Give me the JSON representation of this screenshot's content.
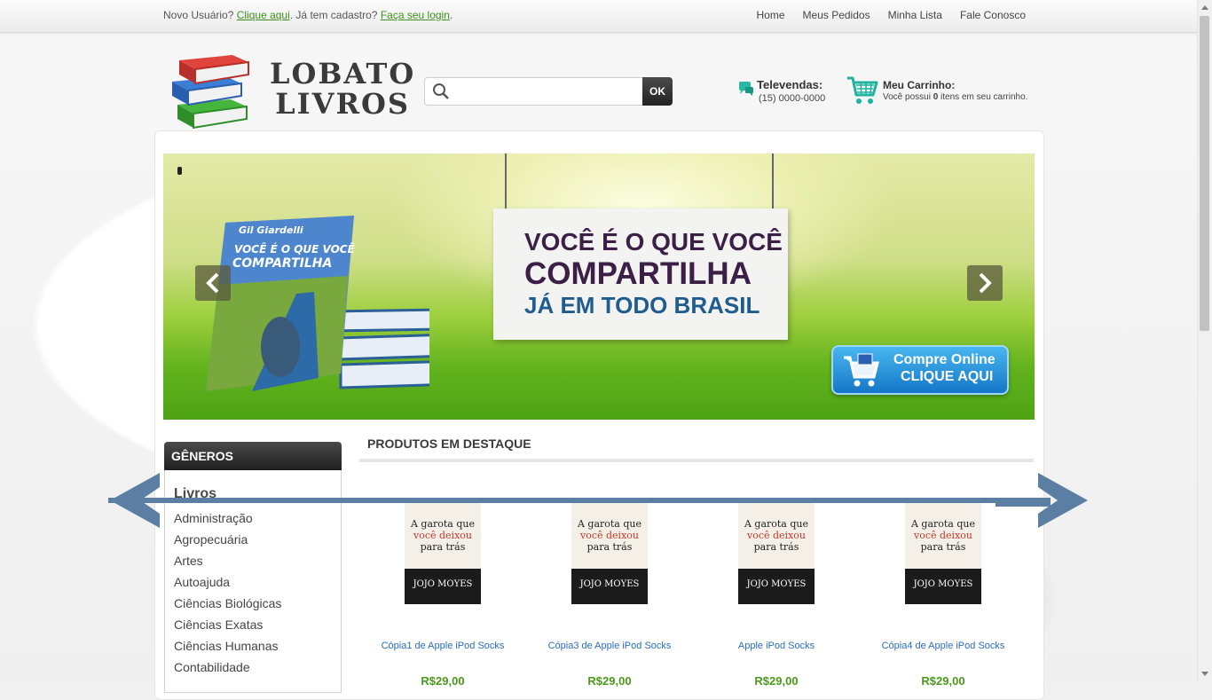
{
  "topbar": {
    "welcome_prefix": "Novo Usuário?",
    "register_link": "Clique aqui",
    "welcome_middle": ". Já tem cadastro?",
    "login_link": "Faça seu login",
    "welcome_suffix": ".",
    "nav": [
      "Home",
      "Meus Pedidos",
      "Minha Lista",
      "Fale Conosco"
    ]
  },
  "logo": {
    "line1": "LOBATO",
    "line2": "LIVROS"
  },
  "search": {
    "placeholder": "",
    "button_label": "OK"
  },
  "televendas": {
    "title": "Televendas:",
    "phone": "(15) 0000-0000"
  },
  "cart": {
    "title": "Meu Carrinho:",
    "desc_prefix": "Você possui ",
    "count": "0",
    "desc_suffix": " itens em seu carrinho."
  },
  "banner": {
    "book_author": "Gil Giardelli",
    "book_title": "VOCÊ É O QUE VOCÊ COMPARTILHA",
    "headline1": "VOCÊ É O QUE VOCÊ",
    "headline2": "COMPARTILHA",
    "headline3": "JÁ EM TODO BRASIL",
    "cta1": "Compre Online",
    "cta2": "CLIQUE AQUI",
    "prev_icon": "chevron-left-icon",
    "next_icon": "chevron-right-icon"
  },
  "sidebar": {
    "header": "GÊNEROS",
    "category": "Livros",
    "items": [
      "Administração",
      "Agropecuária",
      "Artes",
      "Autoajuda",
      "Ciências Biológicas",
      "Ciências Exatas",
      "Ciências Humanas",
      "Contabilidade"
    ]
  },
  "featured": {
    "title": "PRODUTOS EM DESTAQUE",
    "products": [
      {
        "name": "Cópia1 de Apple iPod Socks",
        "price": "R$29,00",
        "cover_line1": "A garota que",
        "cover_line2": "você deixou",
        "cover_line3": "para trás",
        "cover_author": "JOJO MOYES"
      },
      {
        "name": "Cópia3 de Apple iPod Socks",
        "price": "R$29,00",
        "cover_line1": "A garota que",
        "cover_line2": "você deixou",
        "cover_line3": "para trás",
        "cover_author": "JOJO MOYES"
      },
      {
        "name": "Apple iPod Socks",
        "price": "R$29,00",
        "cover_line1": "A garota que",
        "cover_line2": "você deixou",
        "cover_line3": "para trás",
        "cover_author": "JOJO MOYES"
      },
      {
        "name": "Cópia4 de Apple iPod Socks",
        "price": "R$29,00",
        "cover_line1": "A garota que",
        "cover_line2": "você deixou",
        "cover_line3": "para trás",
        "cover_author": "JOJO MOYES"
      }
    ]
  },
  "colors": {
    "link_green": "#3d8f1c",
    "product_blue": "#2a6ebb",
    "price_green": "#4a9a1a",
    "overlay_arrow": "#5a7fa3"
  }
}
